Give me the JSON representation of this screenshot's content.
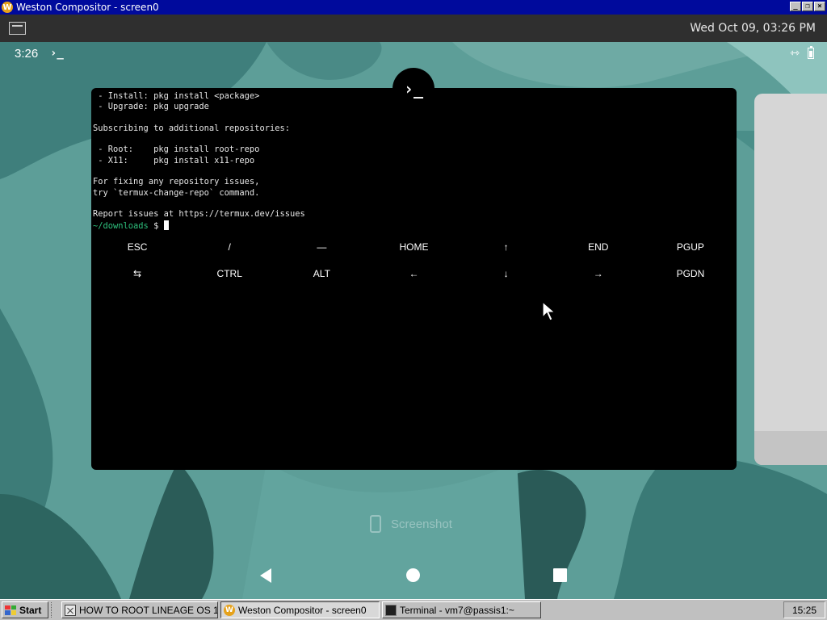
{
  "window": {
    "title": "Weston Compositor - screen0",
    "app_icon_letter": "W",
    "controls": [
      "_",
      "❐",
      "×"
    ]
  },
  "weston_panel": {
    "launcher_icon": "terminal-launcher-icon",
    "clock": "Wed Oct 09, 03:26 PM"
  },
  "android": {
    "status_bar": {
      "time": "3:26",
      "notification_icon": "›_",
      "data_saver_icon": "⇿",
      "battery_icon": "battery-icon"
    },
    "termux_badge": "›_",
    "terminal_lines": [
      " - Install: pkg install <package>",
      " - Upgrade: pkg upgrade",
      "",
      "Subscribing to additional repositories:",
      "",
      " - Root:    pkg install root-repo",
      " - X11:     pkg install x11-repo",
      "",
      "For fixing any repository issues,",
      "try `termux-change-repo` command.",
      "",
      "Report issues at https://termux.dev/issues"
    ],
    "prompt": {
      "path": "~/downloads",
      "symbol": " $ "
    },
    "extra_keys": {
      "row1": [
        "ESC",
        "/",
        "—",
        "HOME",
        "↑",
        "END",
        "PGUP"
      ],
      "row2": [
        "⇆",
        "CTRL",
        "ALT",
        "←",
        "↓",
        "→",
        "PGDN"
      ]
    },
    "screenshot_label": "Screenshot",
    "nav": [
      "back",
      "home",
      "recents"
    ],
    "colors": {
      "wallpaper_base": "#5d9e98",
      "prompt_green": "#2ec27e"
    }
  },
  "taskbar": {
    "start_label": "Start",
    "tasks": [
      {
        "label": "HOW TO ROOT LINEAGE OS 1...",
        "icon": "browser-icon",
        "active": false
      },
      {
        "label": "Weston Compositor - screen0",
        "icon": "weston-icon",
        "active": true
      },
      {
        "label": "Terminal - vm7@passis1:~",
        "icon": "terminal-icon",
        "active": false
      }
    ],
    "clock": "15:25"
  }
}
